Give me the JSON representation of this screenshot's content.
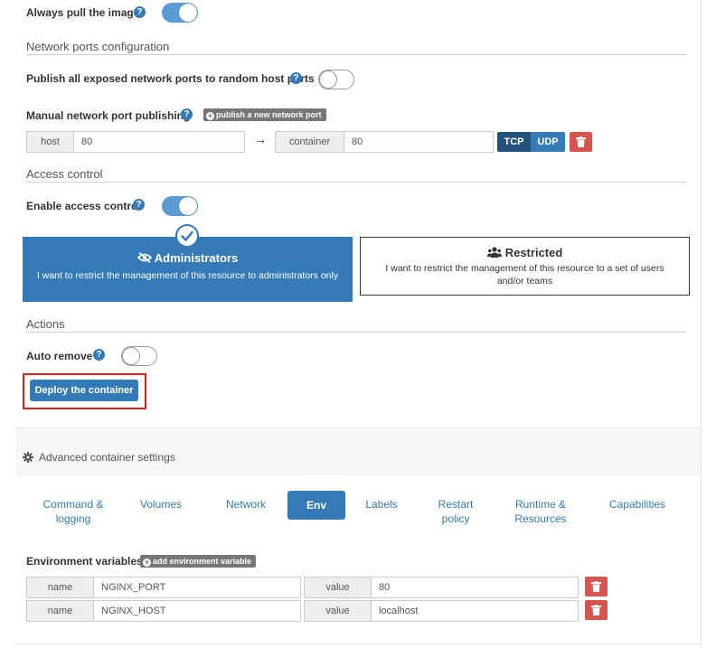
{
  "always_pull": {
    "label": "Always pull the image",
    "enabled": true
  },
  "network_ports": {
    "section_title": "Network ports configuration",
    "publish_all_label": "Publish all exposed network ports to random host ports",
    "publish_all_enabled": false,
    "manual_label": "Manual network port publishing",
    "add_port_label": "publish a new network port",
    "mapping": {
      "host_label": "host",
      "host_value": "80",
      "arrow": "→",
      "container_label": "container",
      "container_value": "80",
      "tcp_label": "TCP",
      "udp_label": "UDP",
      "selected_protocol": "TCP"
    }
  },
  "access_control": {
    "section_title": "Access control",
    "enable_label": "Enable access control",
    "enabled": true,
    "options": [
      {
        "title": "Administrators",
        "description": "I want to restrict the management of this resource to administrators only",
        "selected": true
      },
      {
        "title": "Restricted",
        "description": "I want to restrict the management of this resource to a set of users and/or teams",
        "selected": false
      }
    ]
  },
  "actions": {
    "section_title": "Actions",
    "auto_remove_label": "Auto remove",
    "auto_remove_enabled": false,
    "deploy_label": "Deploy the container"
  },
  "advanced": {
    "title": "Advanced container settings",
    "tabs": [
      {
        "line1": "Command &",
        "line2": "logging",
        "active": false
      },
      {
        "line1": "Volumes",
        "line2": "",
        "active": false
      },
      {
        "line1": "Network",
        "line2": "",
        "active": false
      },
      {
        "line1": "Env",
        "line2": "",
        "active": true
      },
      {
        "line1": "Labels",
        "line2": "",
        "active": false
      },
      {
        "line1": "Restart",
        "line2": "policy",
        "active": false
      },
      {
        "line1": "Runtime &",
        "line2": "Resources",
        "active": false
      },
      {
        "line1": "Capabilities",
        "line2": "",
        "active": false
      }
    ]
  },
  "env": {
    "label": "Environment variables",
    "add_label": "add environment variable",
    "name_label": "name",
    "value_label": "value",
    "vars": [
      {
        "name": "NGINX_PORT",
        "value": "80"
      },
      {
        "name": "NGINX_HOST",
        "value": "localhost"
      }
    ]
  },
  "icons": {
    "help": "?",
    "check": "check-icon",
    "eye_slash": "eye-slash-icon",
    "users": "users-icon",
    "gear": "gear-icon",
    "trash": "trash-icon"
  },
  "colors": {
    "primary": "#337ab7",
    "primary_dark": "#23527c",
    "danger": "#d9534f",
    "highlight": "#e11d1d"
  }
}
